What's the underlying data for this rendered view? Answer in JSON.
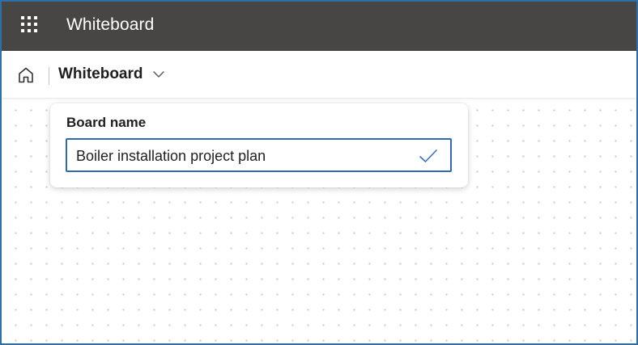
{
  "app_bar": {
    "waffle_icon": "app-launcher-icon",
    "title": "Whiteboard",
    "background": "#484644"
  },
  "command_bar": {
    "home_icon": "home-icon",
    "board_title": "Whiteboard",
    "chevron_icon": "chevron-down-icon"
  },
  "rename_dialog": {
    "label": "Board name",
    "value": "Boiler installation project plan",
    "confirm_icon": "checkmark-icon",
    "accent": "#2e6bb3"
  }
}
